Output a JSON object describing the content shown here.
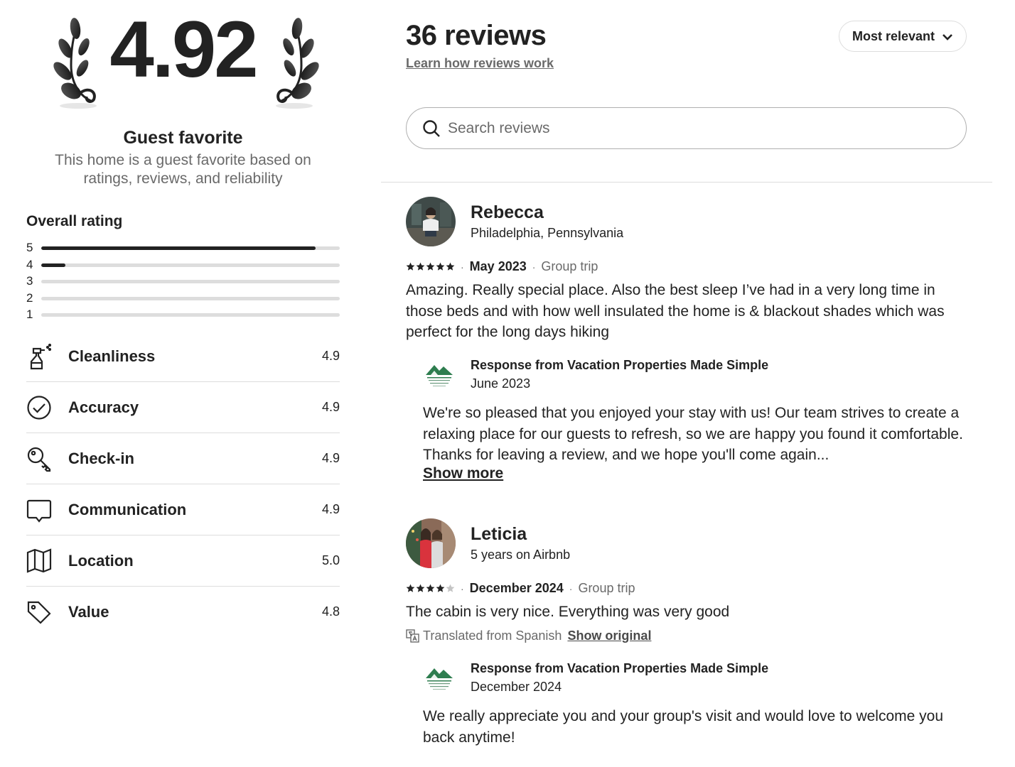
{
  "summary": {
    "rating": "4.92",
    "badge_title": "Guest favorite",
    "badge_subtitle": "This home is a guest favorite based on ratings, reviews, and reliability"
  },
  "overall": {
    "label": "Overall rating",
    "bars": [
      {
        "stars": "5",
        "fraction": 0.92
      },
      {
        "stars": "4",
        "fraction": 0.08
      },
      {
        "stars": "3",
        "fraction": 0
      },
      {
        "stars": "2",
        "fraction": 0
      },
      {
        "stars": "1",
        "fraction": 0
      }
    ]
  },
  "categories": [
    {
      "label": "Cleanliness",
      "value": "4.9",
      "icon": "spray-bottle-icon"
    },
    {
      "label": "Accuracy",
      "value": "4.9",
      "icon": "check-circle-icon"
    },
    {
      "label": "Check-in",
      "value": "4.9",
      "icon": "key-icon"
    },
    {
      "label": "Communication",
      "value": "4.9",
      "icon": "chat-bubble-icon"
    },
    {
      "label": "Location",
      "value": "5.0",
      "icon": "map-icon"
    },
    {
      "label": "Value",
      "value": "4.8",
      "icon": "price-tag-icon"
    }
  ],
  "header": {
    "count": "36 reviews",
    "learn_link": "Learn how reviews work",
    "sort_label": "Most relevant",
    "search_placeholder": "Search reviews"
  },
  "reviews": [
    {
      "name": "Rebecca",
      "subtitle": "Philadelphia, Pennsylvania",
      "stars": 5,
      "date": "May 2023",
      "trip": "Group trip",
      "text": "Amazing. Really special place. Also the best sleep I’ve had in a very long time in those beds and with how well insulated the home is & blackout shades which was perfect for the long days hiking",
      "response": {
        "title": "Response from Vacation Properties Made Simple",
        "date": "June 2023",
        "text": "We're so pleased that you enjoyed your stay with us! Our team strives to create a relaxing place for our guests to refresh, so we are happy you found it comfortable. Thanks for leaving a review, and we hope you'll come again...",
        "show_more": "Show more"
      }
    },
    {
      "name": "Leticia",
      "subtitle": "5 years on Airbnb",
      "stars": 4,
      "date": "December 2024",
      "trip": "Group trip",
      "text": "The cabin is very nice. Everything was very good",
      "translated_note": "Translated from Spanish",
      "show_original": "Show original",
      "response": {
        "title": "Response from Vacation Properties Made Simple",
        "date": "December 2024",
        "text": "We really appreciate you and your group's visit and would love to welcome you back anytime!"
      }
    }
  ],
  "colors": {
    "text": "#222222",
    "muted": "#6a6a6a",
    "divider": "#dddddd",
    "logo_green": "#2e7d4f"
  }
}
